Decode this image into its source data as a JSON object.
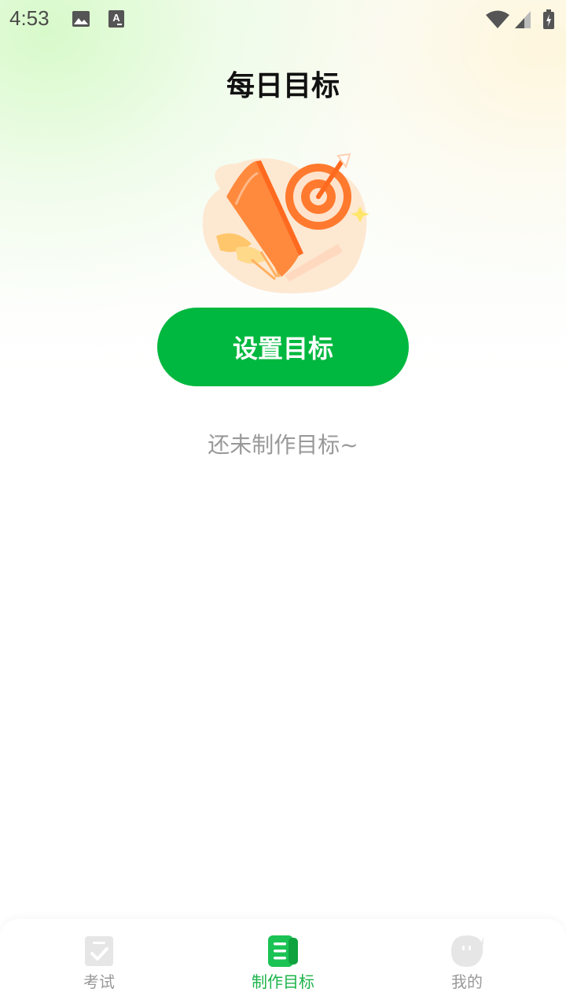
{
  "status_bar": {
    "time": "4:53",
    "icons": [
      "image-icon",
      "text-a-icon",
      "wifi-icon",
      "signal-icon",
      "battery-charging-icon"
    ]
  },
  "page": {
    "title": "每日目标",
    "illustration": "book-target-illustration",
    "set_goal_button": "设置目标",
    "empty_text": "还未制作目标~"
  },
  "tabbar": {
    "tabs": [
      {
        "label": "考试",
        "icon": "exam-icon",
        "active": false
      },
      {
        "label": "制作目标",
        "icon": "goal-icon",
        "active": true
      },
      {
        "label": "我的",
        "icon": "profile-icon",
        "active": false
      }
    ]
  },
  "colors": {
    "primary": "#00b83f",
    "tab_active": "#1bb34a",
    "muted_text": "#999999"
  }
}
